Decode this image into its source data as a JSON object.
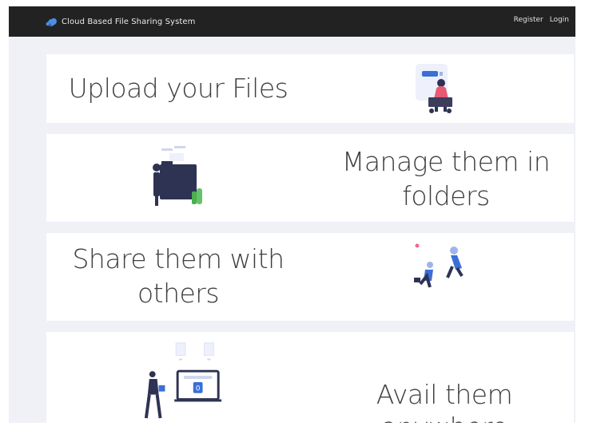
{
  "navbar": {
    "brand": "Cloud Based File Sharing System",
    "links": {
      "register": "Register",
      "login": "Login"
    }
  },
  "cards": {
    "upload": {
      "title": "Upload your Files",
      "illustration": "person-with-laptop-illustration"
    },
    "manage": {
      "line1": "Manage them in",
      "line2": "folders",
      "illustration": "person-with-folder-illustration"
    },
    "share": {
      "line1": "Share them with",
      "line2": "others",
      "illustration": "people-sharing-illustration"
    },
    "avail": {
      "title": "Avail them anywhere",
      "illustration": "person-with-monitor-illustration"
    }
  },
  "colors": {
    "navbar_bg": "#222222",
    "page_bg": "#f0f1f7",
    "card_bg": "#ffffff",
    "text": "#3f3f3f",
    "accent_blue": "#3b6fd8",
    "accent_pink": "#f06a8a",
    "accent_green": "#4caf50",
    "navy": "#2e3354"
  }
}
